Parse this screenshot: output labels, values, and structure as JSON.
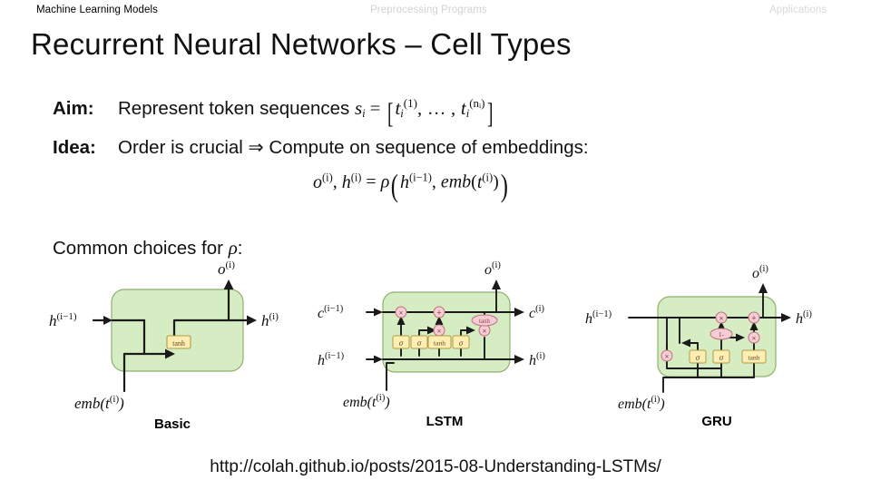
{
  "topnav": {
    "items": [
      {
        "label": "Machine Learning Models",
        "state": "active"
      },
      {
        "label": "Preprocessing Programs",
        "state": "dim"
      },
      {
        "label": "Applications",
        "state": "dim"
      }
    ]
  },
  "slide": {
    "title": "Recurrent Neural Networks – Cell Types",
    "aim": {
      "label": "Aim:",
      "text": "Represent token sequences",
      "formula_plain": "s_i = [ t_i^(1), … , t_i^(n_i) ]",
      "var_s": "s",
      "var_s_sub": "i",
      "eq": "=",
      "bracket_open": "[",
      "bracket_close": "]",
      "term1_base": "t",
      "term1_sub": "i",
      "term1_sup": "(1)",
      "ellipsis": "…",
      "comma": ",",
      "term2_base": "t",
      "term2_sub": "i",
      "term2_sup": "(nᵢ)"
    },
    "idea": {
      "label": "Idea:",
      "text": "Order is crucial ⇒ Compute on sequence of embeddings:",
      "formula_plain": "o^(i), h^(i) = ρ( h^(i−1), emb( t^(i) ) )",
      "o": "o",
      "o_sup": "(i)",
      "h": "h",
      "h_sup": "(i)",
      "eq": "=",
      "rho": "ρ",
      "h_prev": "h",
      "h_prev_sup": "(i−1)",
      "emb": "emb",
      "t": "t",
      "t_sup": "(i)"
    },
    "common_choices": {
      "text": "Common choices for",
      "symbol": "ρ",
      "colon": ":"
    },
    "source_url": "http://colah.github.io/posts/2015-08-Understanding-LSTMs/"
  },
  "colors": {
    "cell_fill": "#d6ecc3",
    "cell_stroke": "#7ba05b",
    "gate_fill": "#ffeeb4",
    "gate_stroke": "#b09b41",
    "op_fill": "#f7cdd5",
    "op_stroke": "#c0707f",
    "wire": "#1a1a1a",
    "nav_active": "#000000",
    "nav_dim": "#d5d5d5"
  },
  "diagrams": [
    {
      "id": "basic",
      "caption": "Basic",
      "inputs": [
        "h^(i−1)",
        "emb(t^(i))"
      ],
      "outputs": [
        "h^(i)",
        "o^(i)"
      ],
      "gates": [
        {
          "label": "tanh",
          "shape": "box"
        }
      ],
      "ops": [],
      "labels": {
        "in_h": "h",
        "in_h_sup": "(i−1)",
        "out_h": "h",
        "out_h_sup": "(i)",
        "out_o": "o",
        "out_o_sup": "(i)",
        "emb": "emb",
        "emb_t": "t",
        "emb_t_sup": "(i)"
      }
    },
    {
      "id": "lstm",
      "caption": "LSTM",
      "inputs": [
        "c^(i−1)",
        "h^(i−1)",
        "emb(t^(i))"
      ],
      "outputs": [
        "c^(i)",
        "h^(i)",
        "o^(i)"
      ],
      "gates": [
        {
          "label": "σ",
          "shape": "box"
        },
        {
          "label": "σ",
          "shape": "box"
        },
        {
          "label": "tanh",
          "shape": "box"
        },
        {
          "label": "σ",
          "shape": "box"
        },
        {
          "label": "tanh",
          "shape": "ellipse"
        }
      ],
      "ops": [
        "×",
        "+",
        "×",
        "×"
      ],
      "labels": {
        "in_c": "c",
        "in_c_sup": "(i−1)",
        "in_h": "h",
        "in_h_sup": "(i−1)",
        "out_c": "c",
        "out_c_sup": "(i)",
        "out_h": "h",
        "out_h_sup": "(i)",
        "out_o": "o",
        "out_o_sup": "(i)",
        "emb": "emb",
        "emb_t": "t",
        "emb_t_sup": "(i)"
      }
    },
    {
      "id": "gru",
      "caption": "GRU",
      "inputs": [
        "h^(i−1)",
        "emb(t^(i))"
      ],
      "outputs": [
        "h^(i)",
        "o^(i)"
      ],
      "gates": [
        {
          "label": "σ",
          "shape": "box"
        },
        {
          "label": "σ",
          "shape": "box"
        },
        {
          "label": "tanh",
          "shape": "box"
        },
        {
          "label": "1-",
          "shape": "ellipse"
        }
      ],
      "ops": [
        "×",
        "×",
        "+",
        "×"
      ],
      "labels": {
        "in_h": "h",
        "in_h_sup": "(i−1)",
        "out_h": "h",
        "out_h_sup": "(i)",
        "out_o": "o",
        "out_o_sup": "(i)",
        "emb": "emb",
        "emb_t": "t",
        "emb_t_sup": "(i)"
      }
    }
  ]
}
